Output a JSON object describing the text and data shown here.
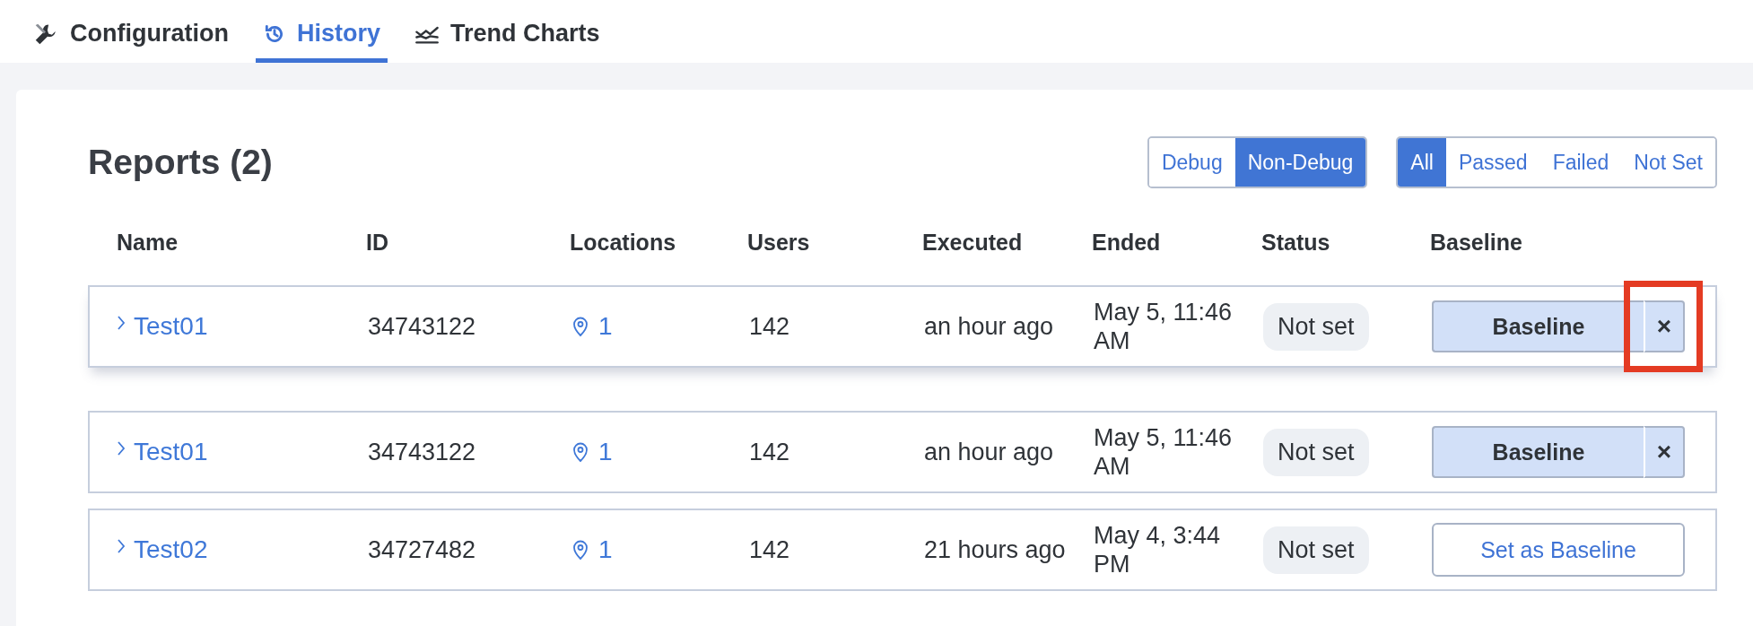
{
  "tabs": [
    {
      "label": "Configuration",
      "kind": "tools",
      "selected": false
    },
    {
      "label": "History",
      "kind": "history",
      "selected": true
    },
    {
      "label": "Trend Charts",
      "kind": "trend",
      "selected": false
    }
  ],
  "reports": {
    "title": "Reports (2)",
    "mode_filter": [
      {
        "label": "Debug",
        "selected": false
      },
      {
        "label": "Non-Debug",
        "selected": true
      }
    ],
    "status_filter": [
      {
        "label": "All",
        "selected": true
      },
      {
        "label": "Passed",
        "selected": false
      },
      {
        "label": "Failed",
        "selected": false
      },
      {
        "label": "Not Set",
        "selected": false
      }
    ],
    "columns": [
      "Name",
      "ID",
      "Locations",
      "Users",
      "Executed",
      "Ended",
      "Status",
      "Baseline"
    ],
    "rows": [
      {
        "name": "Test01",
        "id": "34743122",
        "locations": "1",
        "users": "142",
        "executed": "an hour ago",
        "ended": "May 5, 11:46 AM",
        "status": "Not set",
        "dragging": true,
        "baseline": {
          "kind": "set",
          "label": "Baseline",
          "clear": "×",
          "highlighted": true
        }
      },
      {
        "name": "Test01",
        "id": "34743122",
        "locations": "1",
        "users": "142",
        "executed": "an hour ago",
        "ended": "May 5, 11:46 AM",
        "status": "Not set",
        "dragging": false,
        "baseline": {
          "kind": "set",
          "label": "Baseline",
          "clear": "×",
          "highlighted": false
        }
      },
      {
        "name": "Test02",
        "id": "34727482",
        "locations": "1",
        "users": "142",
        "executed": "21 hours ago",
        "ended": "May 4, 3:44 PM",
        "status": "Not set",
        "dragging": false,
        "baseline": {
          "kind": "action",
          "label": "Set as Baseline",
          "highlighted": false
        }
      }
    ]
  }
}
